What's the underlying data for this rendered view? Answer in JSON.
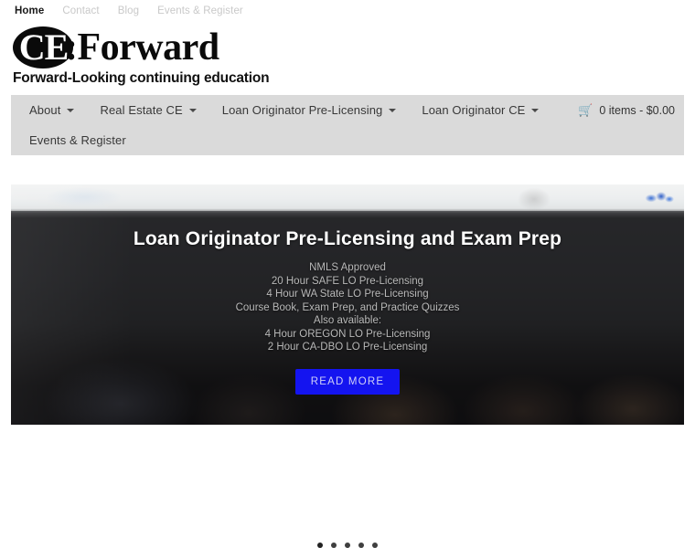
{
  "top_nav": {
    "items": [
      {
        "label": "Home",
        "active": true
      },
      {
        "label": "Contact",
        "active": false
      },
      {
        "label": "Blog",
        "active": false
      },
      {
        "label": "Events & Register",
        "active": false
      }
    ]
  },
  "logo": {
    "badge_text": "CE",
    "wordmark_rest": ":Forward",
    "tagline": "Forward-Looking continuing education"
  },
  "main_nav": {
    "row1": [
      {
        "label": "About",
        "has_caret": true
      },
      {
        "label": "Real Estate CE",
        "has_caret": true
      },
      {
        "label": "Loan Originator Pre-Licensing",
        "has_caret": true
      },
      {
        "label": "Loan Originator CE",
        "has_caret": true
      }
    ],
    "row2": [
      {
        "label": "Events & Register",
        "has_caret": false
      }
    ],
    "cart": {
      "icon": "cart-icon",
      "glyph": "🛒",
      "text": "0 items - $0.00"
    },
    "background_color": "#dadada"
  },
  "hero": {
    "title": "Loan Originator Pre-Licensing and Exam Prep",
    "subtitle_lines": [
      "NMLS Approved",
      "20 Hour SAFE LO Pre-Licensing",
      "4 Hour WA State LO Pre-Licensing",
      "Course Book, Exam Prep, and Practice Quizzes",
      "Also available:",
      "4 Hour OREGON LO Pre-Licensing",
      "2 Hour CA-DBO LO Pre-Licensing"
    ],
    "cta_label": "READ MORE",
    "cta_color": "#1414f0",
    "overlay_color": "rgba(22,22,24,0.52)"
  },
  "slider": {
    "dot_count": 5,
    "active_index": 0
  }
}
